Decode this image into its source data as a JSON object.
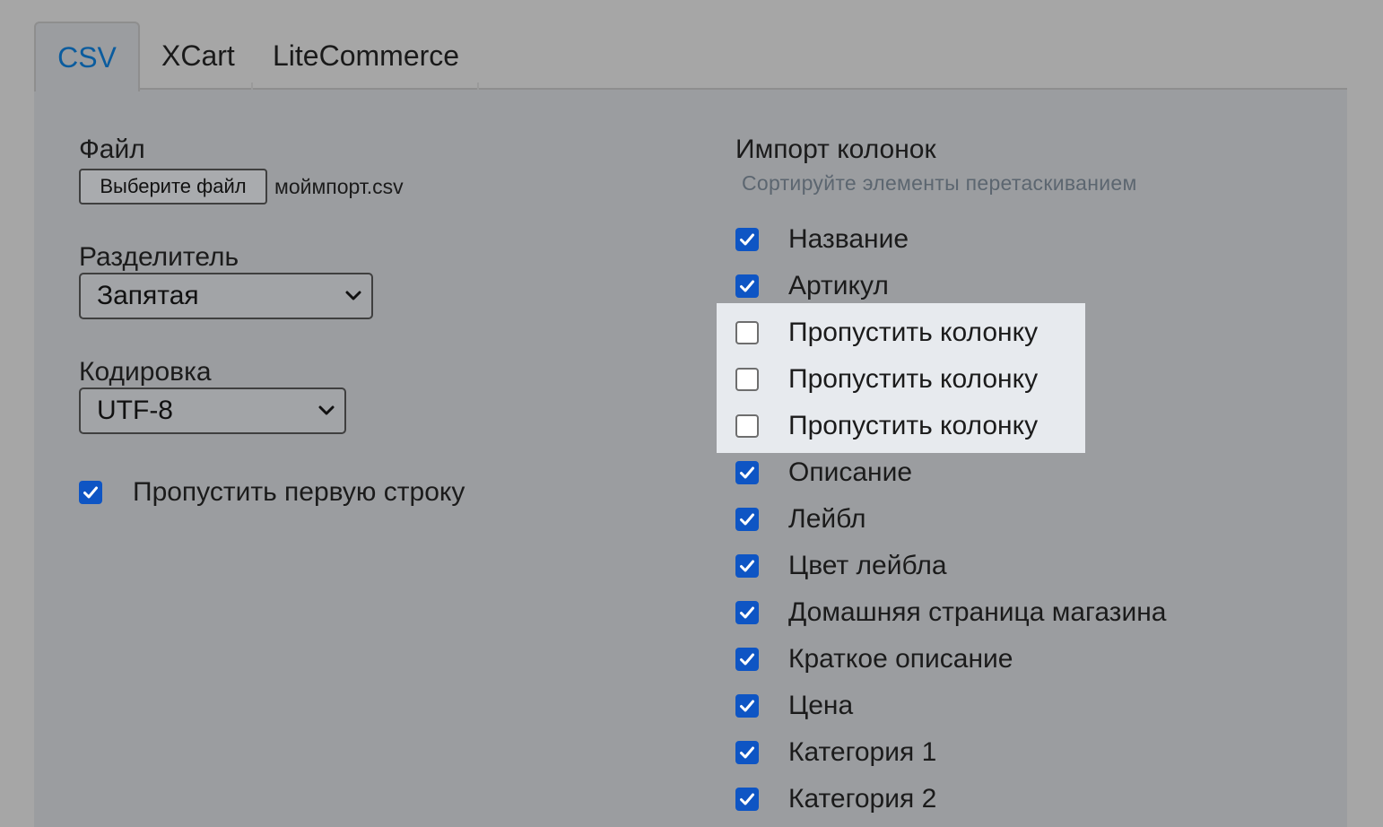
{
  "tabs": [
    {
      "label": "CSV",
      "active": true
    },
    {
      "label": "XCart",
      "active": false
    },
    {
      "label": "LiteCommerce",
      "active": false
    }
  ],
  "file": {
    "label": "Файл",
    "button": "Выберите файл",
    "filename": "моймпорт.csv"
  },
  "delimiter": {
    "label": "Разделитель",
    "value": "Запятая"
  },
  "encoding": {
    "label": "Кодировка",
    "value": "UTF-8"
  },
  "skip_first_row": {
    "label": "Пропустить первую строку",
    "checked": true
  },
  "columns": {
    "title": "Импорт колонок",
    "hint": "Сортируйте элементы перетаскиванием",
    "items": [
      {
        "label": "Название",
        "checked": true
      },
      {
        "label": "Артикул",
        "checked": true
      },
      {
        "label": "Пропустить колонку",
        "checked": false
      },
      {
        "label": "Пропустить колонку",
        "checked": false
      },
      {
        "label": "Пропустить колонку",
        "checked": false
      },
      {
        "label": "Описание",
        "checked": true
      },
      {
        "label": "Лейбл",
        "checked": true
      },
      {
        "label": "Цвет лейбла",
        "checked": true
      },
      {
        "label": "Домашняя страница магазина",
        "checked": true
      },
      {
        "label": "Краткое описание",
        "checked": true
      },
      {
        "label": "Цена",
        "checked": true
      },
      {
        "label": "Категория 1",
        "checked": true
      },
      {
        "label": "Категория 2",
        "checked": true
      }
    ]
  },
  "colors": {
    "accent": "#0e55c4",
    "active_tab_text": "#0b5c9e",
    "highlight": "#e7eaee"
  }
}
